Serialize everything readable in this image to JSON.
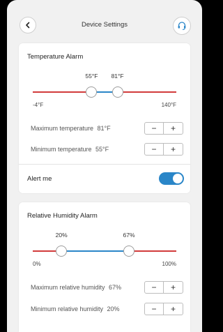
{
  "header": {
    "title": "Device Settings",
    "back_icon": "chevron-left-icon",
    "support_icon": "headset-icon"
  },
  "temperature_alarm": {
    "title": "Temperature Alarm",
    "slider": {
      "min_label": "-4°F",
      "max_label": "140°F",
      "range_min": -4,
      "range_max": 140,
      "low_value": 55,
      "high_value": 81,
      "low_label": "55°F",
      "high_label": "81°F"
    },
    "max_row": {
      "label": "Maximum temperature",
      "value": "81°F"
    },
    "min_row": {
      "label": "Minimum temperature",
      "value": "55°F"
    },
    "alert": {
      "label": "Alert me",
      "enabled": true
    }
  },
  "humidity_alarm": {
    "title": "Relative Humidity Alarm",
    "slider": {
      "min_label": "0%",
      "max_label": "100%",
      "range_min": 0,
      "range_max": 100,
      "low_value": 20,
      "high_value": 67,
      "low_label": "20%",
      "high_label": "67%"
    },
    "max_row": {
      "label": "Maximum relative humidity",
      "value": "67%"
    },
    "min_row": {
      "label": "Minimum relative humidity",
      "value": "20%"
    }
  },
  "stepper": {
    "minus": "−",
    "plus": "+"
  },
  "colors": {
    "out_of_range": "#d23b3b",
    "in_range": "#2a86c8",
    "toggle_on": "#2a86c8"
  }
}
